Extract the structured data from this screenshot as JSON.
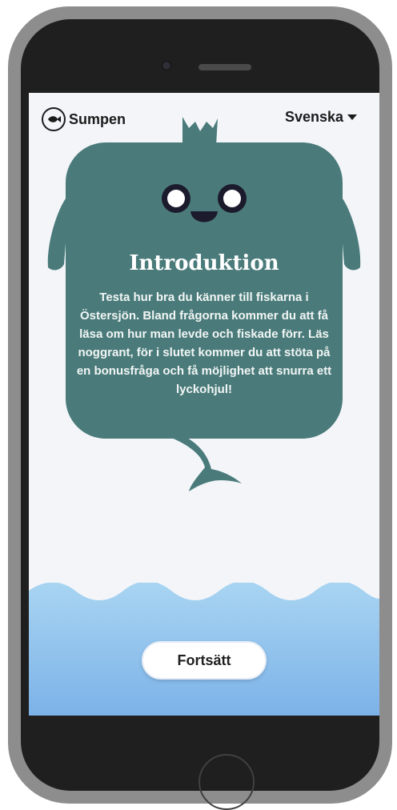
{
  "app": {
    "name": "Sumpen",
    "logo_icon": "fish-icon"
  },
  "language": {
    "selected": "Svenska",
    "icon": "caret-down-icon"
  },
  "intro": {
    "title": "Introduktion",
    "body": "Testa hur bra du känner till fiskarna i Östersjön. Bland frågorna kommer du att få läsa om hur man levde och fiskade förr. Läs noggrant, för i slutet kommer du att stöta på en bonusfråga och få möjlighet att snurra ett lyckohjul!"
  },
  "actions": {
    "continue_label": "Fortsätt"
  },
  "colors": {
    "mascot": "#4a7b7a",
    "water_top": "#a6d2f1",
    "water_bottom": "#7fb3e9",
    "screen_bg": "#f3f5f9"
  }
}
